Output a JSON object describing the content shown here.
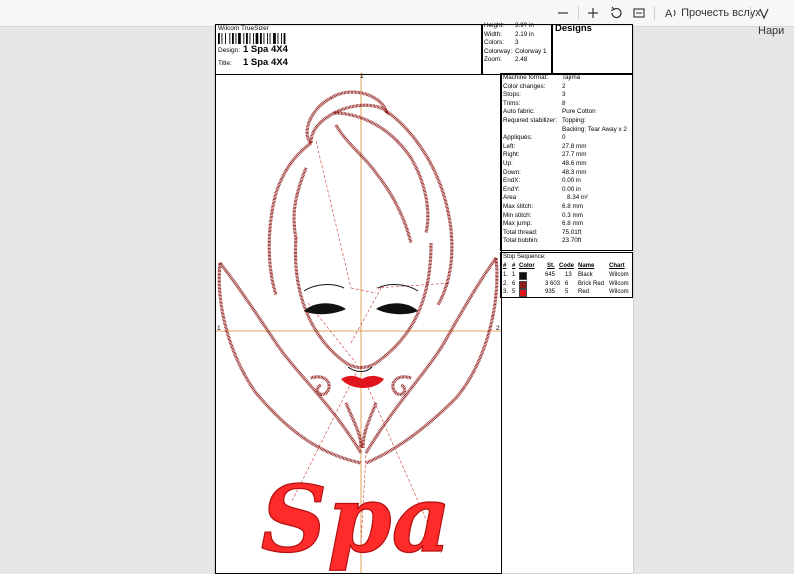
{
  "toolbar": {
    "read_aloud_label": "Прочесть вслух",
    "draw_label": "Нари"
  },
  "sheet": {
    "app_name": "Wilcom TrueSizer",
    "design_label": "Design:",
    "design_value": "1 Spa 4X4",
    "title_label": "Title:",
    "title_value": "1 Spa 4X4",
    "brand": "Designs",
    "size_rows": [
      {
        "label": "Height:",
        "value": "3.9? in"
      },
      {
        "label": "Width:",
        "value": "2.19 in"
      },
      {
        "label": "Colors:",
        "value": "3"
      },
      {
        "label": "Colorway:",
        "value": "Colorway 1"
      },
      {
        "label": "Zoom:",
        "value": "2.48"
      }
    ],
    "info_rows": [
      {
        "label": "Machine format:",
        "value": "Tajima"
      },
      {
        "label": "Color changes:",
        "value": "2"
      },
      {
        "label": "Stops:",
        "value": "3"
      },
      {
        "label": "Trims:",
        "value": "8"
      },
      {
        "label": "Auto fabric:",
        "value": "Pure Cotton"
      },
      {
        "label": "Required stabilizer:",
        "value": "Topping:"
      },
      {
        "label": "",
        "value": "Backing: Tear Away x 2"
      },
      {
        "label": "Appliqués:",
        "value": "0"
      },
      {
        "label": "Left:",
        "value": "27.8 mm"
      },
      {
        "label": "Right:",
        "value": "27.7 mm"
      },
      {
        "label": "Up:",
        "value": "48.6 mm"
      },
      {
        "label": "Down:",
        "value": "48.3 mm"
      },
      {
        "label": "EndX:",
        "value": "0.00 in"
      },
      {
        "label": "EndY:",
        "value": "0.00 in"
      },
      {
        "label": "Area",
        "value": "8.34 in²"
      },
      {
        "label": "Max stitch:",
        "value": "6.8 mm"
      },
      {
        "label": "Min stitch:",
        "value": "0.3 mm"
      },
      {
        "label": "Max jump:",
        "value": "6.8 mm"
      },
      {
        "label": "Total thread:",
        "value": "75.01ft"
      },
      {
        "label": "Total bobbin:",
        "value": "23.70ft"
      }
    ],
    "stop_sequence_title": "Stop Sequence:",
    "stop_headers": {
      "n": "#",
      "n2": "#",
      "color": "Color",
      "st": "St.",
      "code": "Code",
      "name": "Name",
      "chart": "Chart"
    },
    "stops": [
      {
        "n": "1.",
        "n2": "1",
        "color": "#111111",
        "st": "645",
        "code": "13",
        "name": "Black",
        "chart": "Wilcom"
      },
      {
        "n": "2.",
        "n2": "6",
        "color": "#8e1a1a",
        "st": "3 603",
        "code": "6",
        "name": "Brick Red",
        "chart": "Wilcom"
      },
      {
        "n": "3.",
        "n2": "5",
        "color": "#e0141a",
        "st": "935",
        "code": "5",
        "name": "Red",
        "chart": "Wilcom"
      }
    ],
    "axis_marks": {
      "top": "1",
      "left": "1",
      "right": "2"
    },
    "design_word": "Spa"
  }
}
